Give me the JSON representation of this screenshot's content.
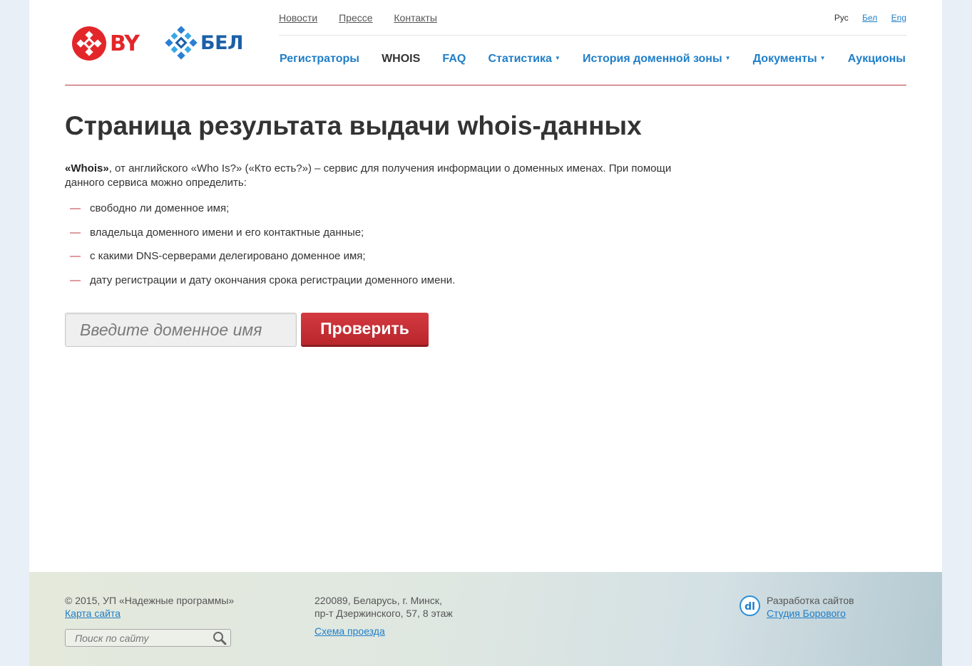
{
  "logos": {
    "by": "BY",
    "bel": "БЕЛ"
  },
  "topnav": [
    "Новости",
    "Прессе",
    "Контакты"
  ],
  "languages": {
    "current": "Рус",
    "bel": "Бел",
    "eng": "Eng"
  },
  "mainnav": {
    "registrars": "Регистраторы",
    "whois": "WHOIS",
    "faq": "FAQ",
    "stats": "Статистика",
    "history": "История доменной зоны",
    "docs": "Документы",
    "auctions": "Аукционы"
  },
  "page_title": "Страница результата выдачи whois-данных",
  "intro": {
    "term": "«Whois»",
    "text": ", от английского «Who Is?» («Кто есть?») – сервис для получения информации о доменных именах. При помощи данного сервиса можно определить:"
  },
  "features": [
    "свободно ли доменное имя;",
    "владельца доменного имени и его контактные данные;",
    "с какими DNS-серверами делегировано доменное имя;",
    "дату регистрации и дату окончания срока регистрации доменного имени."
  ],
  "list_dash": "—",
  "whois_form": {
    "placeholder": "Введите доменное имя",
    "button": "Проверить"
  },
  "footer": {
    "copyright": "© 2015, УП «Надежные программы»",
    "sitemap": "Карта сайта",
    "search_placeholder": "Поиск по сайту",
    "address_line1": "220089, Беларусь, г. Минск,",
    "address_line2": "пр-т Дзержинского, 57, 8 этаж",
    "map_link": "Схема проезда",
    "dev_label": "Разработка сайтов",
    "dev_link": "Студия Борового"
  },
  "colors": {
    "accent_blue": "#1f7ec8",
    "accent_red": "#c0393f",
    "brand_blue": "#1b5fa8",
    "brand_red": "#e3262a"
  },
  "icons": [
    "by-logo-icon",
    "bel-logo-icon",
    "caret-down-icon",
    "search-icon",
    "studio-logo-icon"
  ]
}
